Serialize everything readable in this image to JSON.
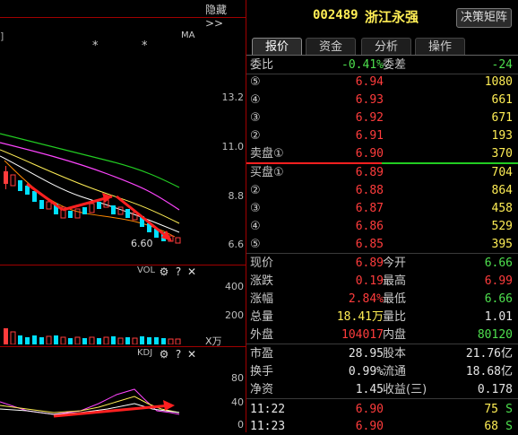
{
  "chart": {
    "hide_label": "隐藏>>",
    "ma_label": "MA",
    "star_marks": [
      "*",
      "*"
    ],
    "price_ticks": [
      "13.2",
      "11.0",
      "8.8",
      "6.6"
    ],
    "low_mark": "6.60",
    "vol": {
      "title": "VOL",
      "ticks": [
        "400",
        "200"
      ],
      "unit": "X万"
    },
    "kdj": {
      "title": "KDJ",
      "ticks": [
        "80",
        "40",
        "0"
      ]
    },
    "colors": {
      "up": "#ff3c3c",
      "down": "#00e0ff",
      "ma1": "#ffffff",
      "ma2": "#ffee55",
      "ma3": "#ff44ff",
      "ma4": "#22cc22"
    }
  },
  "quote": {
    "code": "002489",
    "name": "浙江永强",
    "decision_btn": "决策矩阵",
    "tabs": [
      "报价",
      "资金",
      "分析",
      "操作"
    ],
    "weibi": {
      "label": "委比",
      "value": "-0.41%",
      "diff_label": "委差",
      "diff_value": "-24"
    },
    "sell": [
      {
        "label": "⑤",
        "price": "6.94",
        "vol": "1080"
      },
      {
        "label": "④",
        "price": "6.93",
        "vol": "661"
      },
      {
        "label": "③",
        "price": "6.92",
        "vol": "671"
      },
      {
        "label": "②",
        "price": "6.91",
        "vol": "193"
      },
      {
        "label": "卖盘①",
        "price": "6.90",
        "vol": "370"
      }
    ],
    "buy": [
      {
        "label": "买盘①",
        "price": "6.89",
        "vol": "704"
      },
      {
        "label": "②",
        "price": "6.88",
        "vol": "864"
      },
      {
        "label": "③",
        "price": "6.87",
        "vol": "458"
      },
      {
        "label": "④",
        "price": "6.86",
        "vol": "529"
      },
      {
        "label": "⑤",
        "price": "6.85",
        "vol": "395"
      }
    ],
    "stats1": [
      {
        "l1": "现价",
        "v1": "6.89",
        "c1": "red",
        "l2": "今开",
        "v2": "6.66",
        "c2": "grn"
      },
      {
        "l1": "涨跌",
        "v1": "0.19",
        "c1": "red",
        "l2": "最高",
        "v2": "6.99",
        "c2": "red"
      },
      {
        "l1": "涨幅",
        "v1": "2.84%",
        "c1": "red",
        "l2": "最低",
        "v2": "6.66",
        "c2": "grn"
      },
      {
        "l1": "总量",
        "v1": "18.41万",
        "c1": "yel",
        "l2": "量比",
        "v2": "1.01",
        "c2": "wht"
      },
      {
        "l1": "外盘",
        "v1": "104017",
        "c1": "red",
        "l2": "内盘",
        "v2": "80120",
        "c2": "grn"
      }
    ],
    "stats2": [
      {
        "l1": "市盈",
        "v1": "28.95",
        "c1": "wht",
        "l2": "股本",
        "v2": "21.76亿",
        "c2": "wht"
      },
      {
        "l1": "换手",
        "v1": "0.99%",
        "c1": "wht",
        "l2": "流通",
        "v2": "18.68亿",
        "c2": "wht"
      },
      {
        "l1": "净资",
        "v1": "1.45",
        "c1": "wht",
        "l2": "收益(三)",
        "v2": "0.178",
        "c2": "wht"
      }
    ],
    "ticks": [
      {
        "time": "11:22",
        "price": "6.90",
        "vol": "75",
        "side": "S"
      },
      {
        "time": "11:23",
        "price": "6.90",
        "vol": "68",
        "side": "S"
      }
    ]
  }
}
